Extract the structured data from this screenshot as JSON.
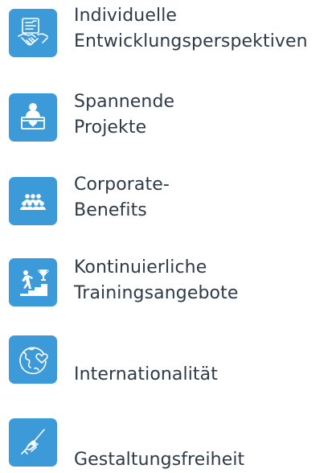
{
  "benefits": [
    {
      "icon": "handshake-document-icon",
      "lines": [
        "Individuelle",
        "Entwicklungsperspektiven"
      ]
    },
    {
      "icon": "presenter-heart-icon",
      "lines": [
        "Spannende",
        "Projekte"
      ]
    },
    {
      "icon": "group-people-icon",
      "lines": [
        "Corporate-",
        "Benefits"
      ]
    },
    {
      "icon": "stairs-trophy-icon",
      "lines": [
        "Kontinuierliche",
        "Trainingsangebote"
      ]
    },
    {
      "icon": "globe-heart-icon",
      "lines": [
        "Internationalität"
      ]
    },
    {
      "icon": "hand-brush-icon",
      "lines": [
        "Gestaltungsfreiheit"
      ]
    }
  ],
  "colors": {
    "icon_background": "#3c9ad9",
    "icon_stroke": "#ffffff",
    "text": "#2e3a48"
  }
}
